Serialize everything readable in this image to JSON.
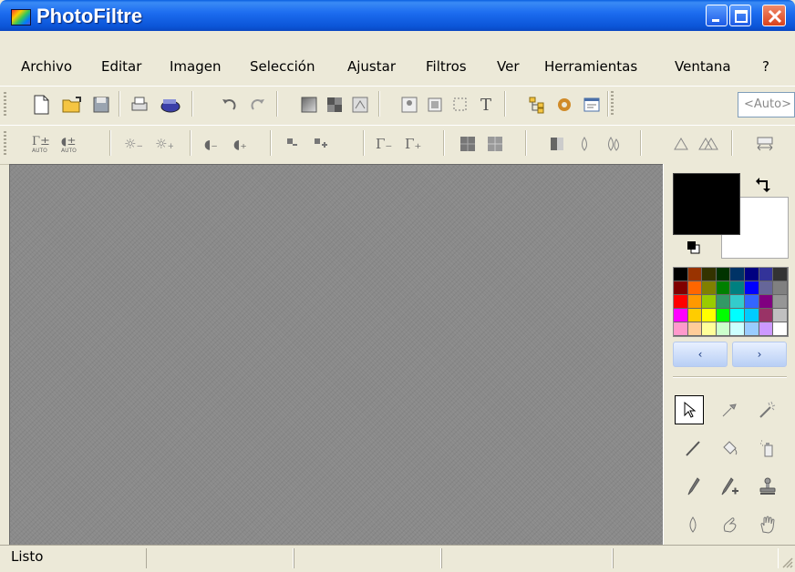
{
  "window": {
    "title": "PhotoFiltre"
  },
  "menu": [
    {
      "label": "Archivo"
    },
    {
      "label": "Editar"
    },
    {
      "label": "Imagen"
    },
    {
      "label": "Selección"
    },
    {
      "label": "Ajustar"
    },
    {
      "label": "Filtros"
    },
    {
      "label": "Ver"
    },
    {
      "label": "Herramientas"
    },
    {
      "label": "Ventana"
    },
    {
      "label": "?"
    }
  ],
  "toolbar": {
    "zoom_value": "<Auto>"
  },
  "colors": {
    "foreground": "#000000",
    "background": "#ffffff"
  },
  "palette": [
    "#000000",
    "#993300",
    "#333300",
    "#003300",
    "#003366",
    "#000080",
    "#333399",
    "#333333",
    "#800000",
    "#ff6600",
    "#808000",
    "#008000",
    "#008080",
    "#0000ff",
    "#666699",
    "#808080",
    "#ff0000",
    "#ff9900",
    "#99cc00",
    "#339966",
    "#33cccc",
    "#3366ff",
    "#800080",
    "#969696",
    "#ff00ff",
    "#ffcc00",
    "#ffff00",
    "#00ff00",
    "#00ffff",
    "#00ccff",
    "#993366",
    "#c0c0c0",
    "#ff99cc",
    "#ffcc99",
    "#ffff99",
    "#ccffcc",
    "#ccffff",
    "#99ccff",
    "#cc99ff",
    "#ffffff"
  ],
  "palette_nav": {
    "prev": "‹",
    "next": "›"
  },
  "status": {
    "text": "Listo"
  }
}
